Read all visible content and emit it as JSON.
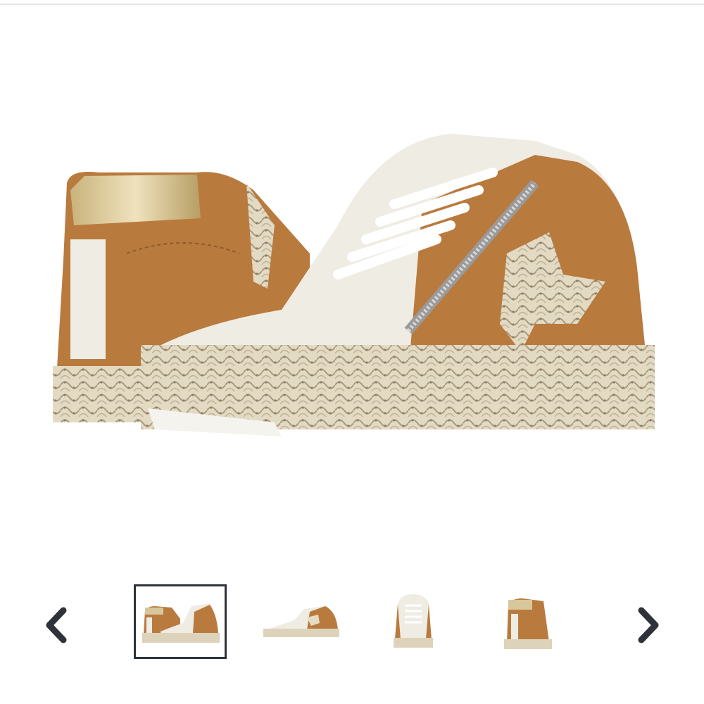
{
  "gallery": {
    "main_image": {
      "icon": "sneaker-image",
      "description_icon": "mid-top-sneaker-pair"
    },
    "prev_icon": "chevron-left-icon",
    "next_icon": "chevron-right-icon",
    "selected_index": 0,
    "thumbnails": [
      {
        "view": "pair"
      },
      {
        "view": "side"
      },
      {
        "view": "front"
      },
      {
        "view": "back"
      }
    ]
  },
  "colors": {
    "arrow": "#2e3339",
    "tan": "#b97a3e",
    "cream": "#efece4",
    "gold": "#d8c79a",
    "snake": "#d9cfb6"
  }
}
